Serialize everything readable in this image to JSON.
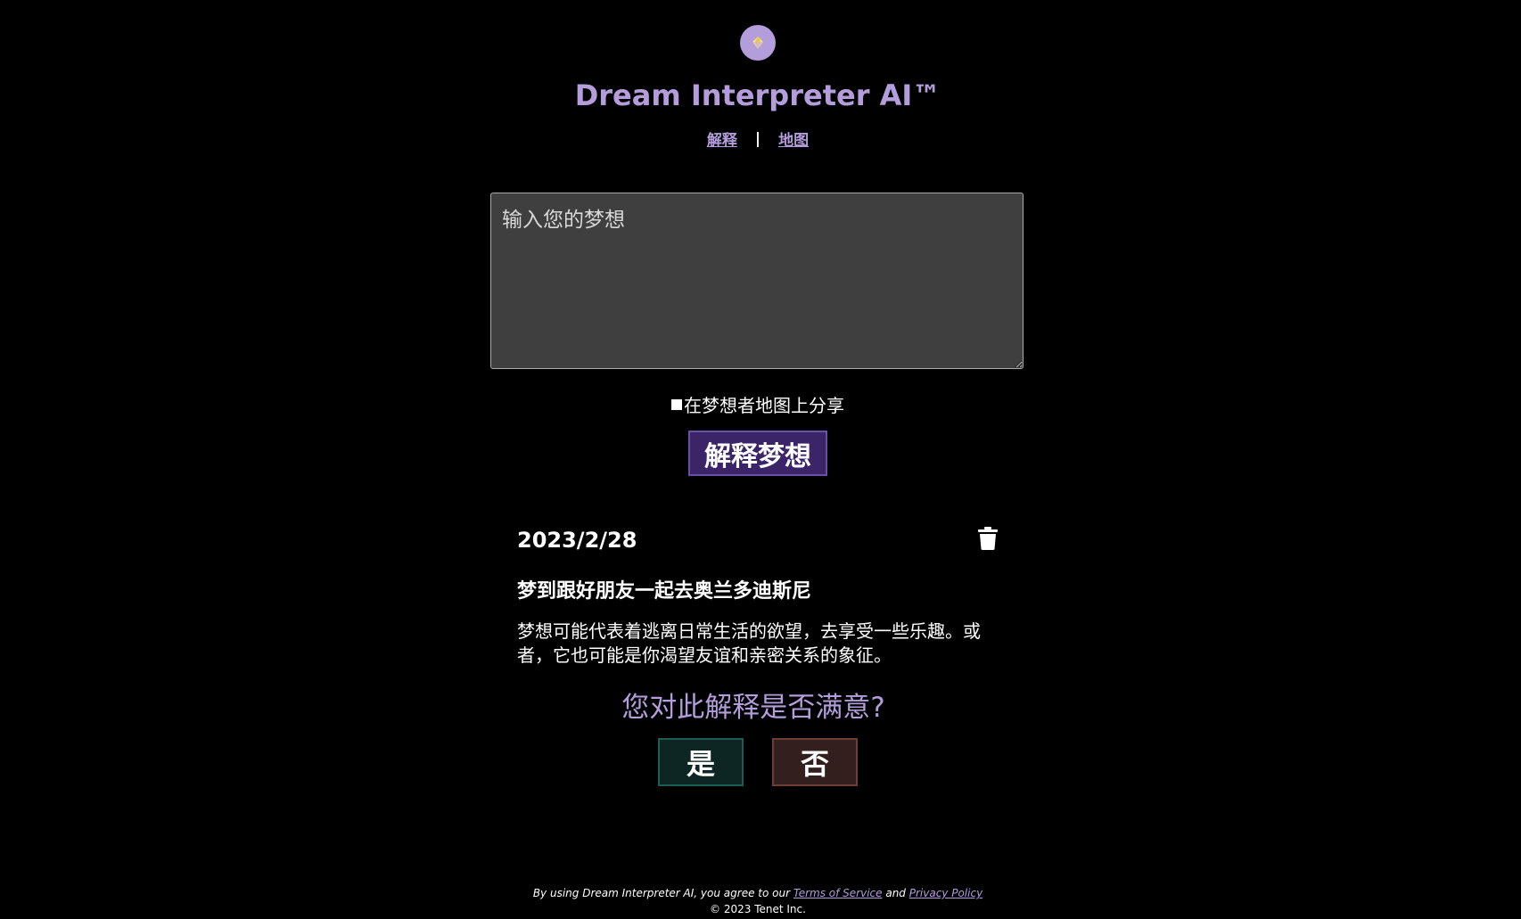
{
  "app": {
    "title": "Dream Interpreter AI™",
    "logo_icon": "diamond-icon"
  },
  "nav": {
    "items": [
      {
        "label": "解释"
      },
      {
        "label": "地图"
      }
    ],
    "separator": "|"
  },
  "form": {
    "dream_placeholder": "输入您的梦想",
    "dream_value": "",
    "share_label": "在梦想者地图上分享",
    "share_checked": false,
    "submit_label": "解释梦想"
  },
  "entry": {
    "date": "2023/2/28",
    "delete_icon": "trash-icon",
    "title": "梦到跟好朋友一起去奥兰多迪斯尼",
    "interpretation": "梦想可能代表着逃离日常生活的欲望，去享受一些乐趣。或者，它也可能是你渴望友谊和亲密关系的象征。"
  },
  "feedback": {
    "question": "您对此解释是否满意?",
    "yes_label": "是",
    "no_label": "否"
  },
  "footer": {
    "terms_prefix": "By using Dream Interpreter AI, you agree to our",
    "terms_link": "Terms of Service",
    "and_text": "and",
    "privacy_link": "Privacy Policy",
    "copyright": "© 2023 Tenet Inc."
  },
  "colors": {
    "background": "#000000",
    "accent": "#b39ddb",
    "primary_button": "#3b2467",
    "yes_button": "#0d2623",
    "no_button": "#33201e"
  }
}
